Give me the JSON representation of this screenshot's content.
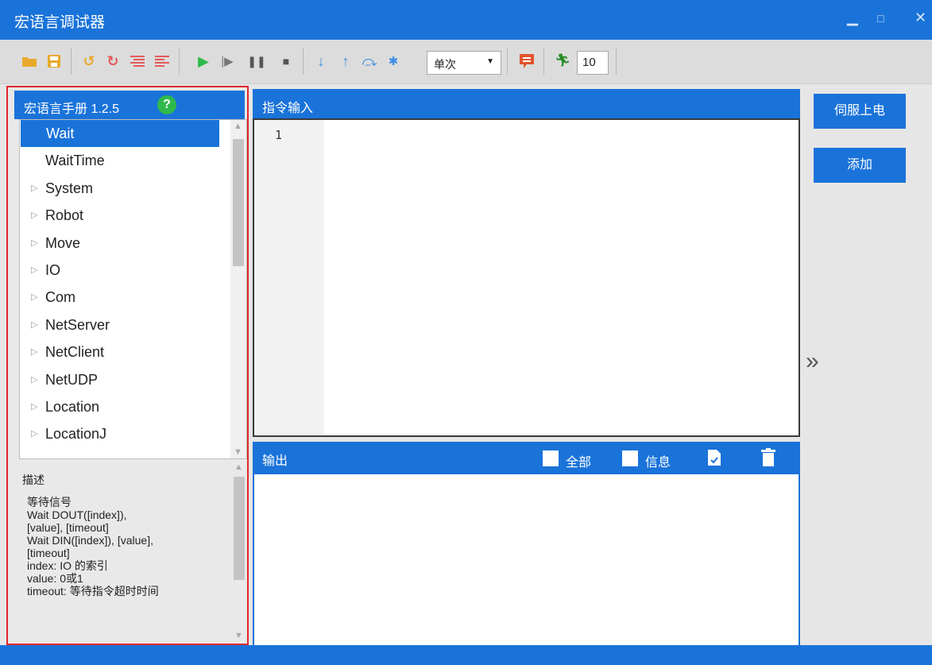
{
  "window": {
    "title": "宏语言调试器",
    "controls": [
      "minimize-icon",
      "maximize-icon",
      "close-icon"
    ]
  },
  "toolbar": {
    "icons": [
      "open-folder-icon",
      "save-icon",
      "undo-icon",
      "redo-icon",
      "comment-icon",
      "uncomment-icon",
      "run-icon",
      "step-run-icon",
      "pause-icon",
      "stop-icon",
      "step-into-icon",
      "step-out-icon",
      "step-over-icon",
      "debug-icon",
      "message-icon",
      "runner-icon"
    ],
    "mode_value": "单次",
    "count_value": "10"
  },
  "manual": {
    "title": "宏语言手册 1.2.5",
    "items": [
      {
        "label": "Wait",
        "expandable": false,
        "selected": true
      },
      {
        "label": "WaitTime",
        "expandable": false,
        "selected": false
      },
      {
        "label": "System",
        "expandable": true,
        "selected": false
      },
      {
        "label": "Robot",
        "expandable": true,
        "selected": false
      },
      {
        "label": "Move",
        "expandable": true,
        "selected": false
      },
      {
        "label": "IO",
        "expandable": true,
        "selected": false
      },
      {
        "label": "Com",
        "expandable": true,
        "selected": false
      },
      {
        "label": "NetServer",
        "expandable": true,
        "selected": false
      },
      {
        "label": "NetClient",
        "expandable": true,
        "selected": false
      },
      {
        "label": "NetUDP",
        "expandable": true,
        "selected": false
      },
      {
        "label": "Location",
        "expandable": true,
        "selected": false
      },
      {
        "label": "LocationJ",
        "expandable": true,
        "selected": false
      }
    ],
    "description_title": "描述",
    "description_lines": [
      "等待信号",
      " Wait DOUT([index]),",
      "[value], [timeout]",
      " Wait DIN([index]), [value],",
      "[timeout]",
      " index: IO 的索引",
      " value: 0或1",
      " timeout: 等待指令超时时间"
    ]
  },
  "editor": {
    "header": "指令输入",
    "line_number": "1"
  },
  "output": {
    "header": "输出",
    "filter_all": "全部",
    "filter_info": "信息"
  },
  "actions": {
    "servo_on": "伺服上电",
    "add": "添加"
  },
  "colors": {
    "accent": "#1a73d9",
    "highlight_border": "#e0262b"
  }
}
